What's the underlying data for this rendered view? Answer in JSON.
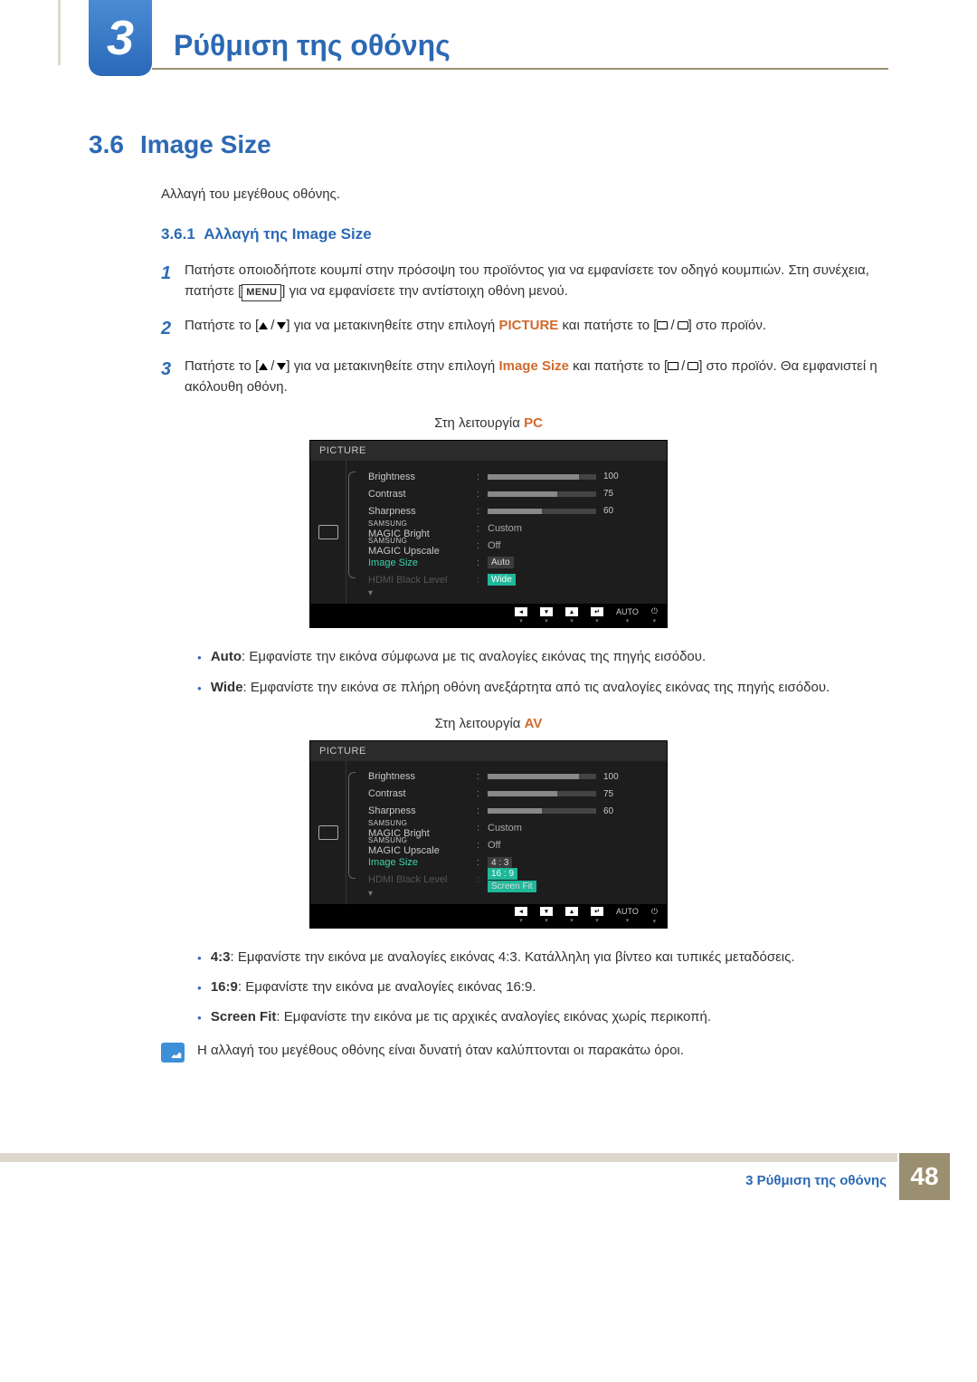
{
  "chapter": {
    "num": "3",
    "title": "Ρύθμιση της οθόνης"
  },
  "section": {
    "num": "3.6",
    "title": "Image Size"
  },
  "intro": "Αλλαγή του μεγέθους οθόνης.",
  "subsection": {
    "num": "3.6.1",
    "title": "Αλλαγή της Image Size"
  },
  "steps": {
    "s1": "Πατήστε οποιοδήποτε κουμπί στην πρόσοψη του προϊόντος για να εμφανίσετε τον οδηγό κουμπιών. Στη συνέχεια, πατήστε ",
    "s1b": " για να εμφανίσετε την αντίστοιχη οθόνη μενού.",
    "menu": "MENU",
    "s2a": "Πατήστε το [",
    "s2b": "] για να μετακινηθείτε στην επιλογή ",
    "picture": "PICTURE",
    "s2c": " και πατήστε το [",
    "s2d": "] στο προϊόν.",
    "s3a": "Πατήστε το [",
    "s3b": "] για να μετακινηθείτε στην επιλογή ",
    "imgsize": "Image Size",
    "s3c": " και πατήστε το [",
    "s3d": "] στο προϊόν. Θα εμφανιστεί η ακόλουθη οθόνη."
  },
  "cap_pc_a": "Στη λειτουργία ",
  "cap_pc_b": "PC",
  "cap_av_a": "Στη λειτουργία ",
  "cap_av_b": "AV",
  "osd": {
    "head": "PICTURE",
    "rows": {
      "brightness": {
        "label": "Brightness",
        "val": "100",
        "pct": 84
      },
      "contrast": {
        "label": "Contrast",
        "val": "75",
        "pct": 64
      },
      "sharpness": {
        "label": "Sharpness",
        "val": "60",
        "pct": 50
      },
      "magic_bright": {
        "label_top": "SAMSUNG",
        "label_bot": "MAGIC Bright",
        "val": "Custom"
      },
      "magic_upscale": {
        "label_top": "SAMSUNG",
        "label_bot": "MAGIC Upscale",
        "val": "Off"
      },
      "image_size": {
        "label": "Image Size"
      },
      "hdmi": {
        "label": "HDMI Black Level"
      }
    },
    "pc_opts": {
      "o1": "Auto",
      "o2": "Wide"
    },
    "av_opts": {
      "o1": "4 : 3",
      "o2": "16 : 9",
      "o3": "Screen Fit"
    },
    "foot_auto": "AUTO"
  },
  "bul_pc": {
    "auto_l": "Auto",
    "auto_t": ": Εμφανίστε την εικόνα σύμφωνα με τις αναλογίες εικόνας της πηγής εισόδου.",
    "wide_l": "Wide",
    "wide_t": ": Εμφανίστε την εικόνα σε πλήρη οθόνη ανεξάρτητα από τις αναλογίες εικόνας της πηγής εισόδου."
  },
  "bul_av": {
    "r43_l": "4:3",
    "r43_t": ": Εμφανίστε την εικόνα με αναλογίες εικόνας 4:3. Κατάλληλη για βίντεο και τυπικές μεταδόσεις.",
    "r169_l": "16:9",
    "r169_t": ": Εμφανίστε την εικόνα με αναλογίες εικόνας 16:9.",
    "sf_l": "Screen Fit",
    "sf_t": ": Εμφανίστε την εικόνα με τις αρχικές αναλογίες εικόνας χωρίς περικοπή."
  },
  "note": "Η αλλαγή του μεγέθους οθόνης είναι δυνατή όταν καλύπτονται οι παρακάτω όροι.",
  "footer": {
    "text": "3 Ρύθμιση της οθόνης",
    "page": "48"
  }
}
